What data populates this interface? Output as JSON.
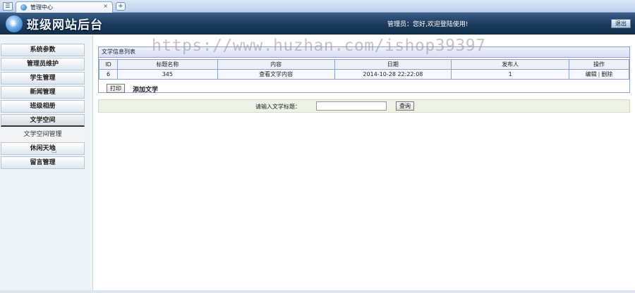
{
  "browser": {
    "tab_title": "管理中心",
    "menu_glyph": "☰",
    "close_glyph": "×",
    "new_tab_glyph": "+"
  },
  "header": {
    "site_title": "班级网站后台",
    "welcome": "管理员：您好,欢迎登陆使用!",
    "logout_label": "退出"
  },
  "sidebar": {
    "items": [
      {
        "label": "系统参数"
      },
      {
        "label": "管理员维护"
      },
      {
        "label": "学生管理"
      },
      {
        "label": "新闻管理"
      },
      {
        "label": "班级相册"
      },
      {
        "label": "文学空间"
      },
      {
        "label": "休闲天地"
      },
      {
        "label": "留言管理"
      }
    ],
    "active_sub": "文学空间管理"
  },
  "panel": {
    "title": "文学信息列表",
    "columns": [
      "ID",
      "标题名称",
      "内容",
      "日期",
      "发布人",
      "操作"
    ],
    "rows": [
      {
        "id": "6",
        "title": "345",
        "content": "查看文学内容",
        "date": "2014-10-28 22:22:08",
        "publisher": "1",
        "edit": "编辑",
        "delete": "删除"
      }
    ],
    "print_label": "打印",
    "add_label": "添加文学"
  },
  "search": {
    "label": "请输入文学标题：",
    "value": "",
    "button_label": "查询"
  },
  "watermark": "https://www.huzhan.com/ishop39397",
  "colors": {
    "header_bg": "#1c3a5c",
    "table_border": "#8e9fd0",
    "search_bg": "#eef2e6"
  }
}
